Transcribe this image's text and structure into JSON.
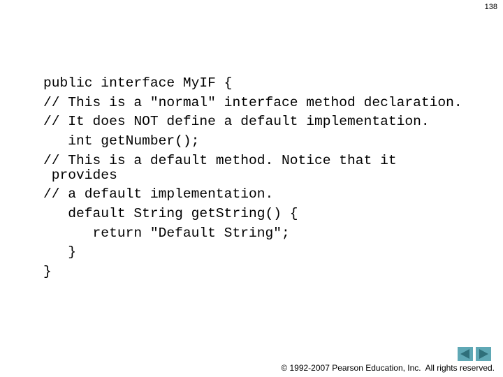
{
  "slide": {
    "page_number": "138",
    "code_lines": [
      {
        "text": "public interface MyIF {"
      },
      {
        "text": "// This is a \"normal\" interface method declaration."
      },
      {
        "text": "// It does NOT define a default implementation."
      },
      {
        "text": "   int getNumber();"
      },
      {
        "text": "// This is a default method. Notice that it"
      },
      {
        "text": " provides"
      },
      {
        "text": "// a default implementation."
      },
      {
        "text": "   default String getString() {"
      },
      {
        "text": "      return \"Default String\";"
      },
      {
        "text": "   }"
      },
      {
        "text": "}"
      }
    ]
  },
  "navigation": {
    "prev_icon": "triangle-left-icon",
    "next_icon": "triangle-right-icon",
    "button_color": "#5fa8b5",
    "arrow_color": "#2f6f7a"
  },
  "footer": {
    "copyright": "© 1992-2007 Pearson Education, Inc.  All rights reserved."
  }
}
